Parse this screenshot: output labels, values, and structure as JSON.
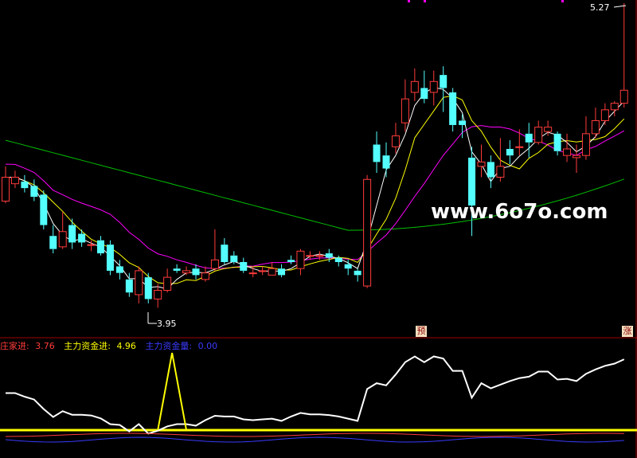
{
  "watermark": "www.6o7o.com",
  "markers": {
    "high": "5.27",
    "low": "3.95",
    "pre": "预",
    "up": "涨"
  },
  "legend": {
    "item1": {
      "label": "庄家进:",
      "value": "3.76",
      "color": "#ff3b3b"
    },
    "item2": {
      "label": "主力资金进:",
      "value": "4.96",
      "color": "#ffff00"
    },
    "item3": {
      "label": "主力资金量:",
      "value": "0.00",
      "color": "#3a3aff"
    }
  },
  "colors": {
    "up": "#ff3b3b",
    "down": "#54ffff",
    "ma5": "#ffffff",
    "ma10": "#ffff00",
    "ma20": "#ff00ff",
    "ma60": "#00c000",
    "separator": "#a00000"
  },
  "chart_data": {
    "type": "candlestick",
    "ylim": [
      3.9,
      5.35
    ],
    "candles": [
      [
        4.44,
        4.55,
        4.6,
        4.43
      ],
      [
        4.52,
        4.55,
        4.58,
        4.5
      ],
      [
        4.53,
        4.5,
        4.56,
        4.48
      ],
      [
        4.51,
        4.46,
        4.54,
        4.44
      ],
      [
        4.47,
        4.33,
        4.49,
        4.31
      ],
      [
        4.28,
        4.22,
        4.33,
        4.2
      ],
      [
        4.23,
        4.3,
        4.39,
        4.22
      ],
      [
        4.33,
        4.25,
        4.36,
        4.22
      ],
      [
        4.29,
        4.25,
        4.31,
        4.23
      ],
      [
        4.24,
        4.24,
        4.26,
        4.21
      ],
      [
        4.26,
        4.2,
        4.28,
        4.19
      ],
      [
        4.24,
        4.12,
        4.26,
        4.1
      ],
      [
        4.14,
        4.11,
        4.17,
        4.08
      ],
      [
        4.08,
        4.02,
        4.11,
        4.0
      ],
      [
        4.01,
        4.12,
        4.14,
        3.97
      ],
      [
        4.09,
        3.99,
        4.11,
        3.97
      ],
      [
        3.99,
        4.03,
        4.06,
        3.95
      ],
      [
        4.03,
        4.09,
        4.13,
        4.02
      ],
      [
        4.13,
        4.12,
        4.15,
        4.11
      ],
      [
        4.11,
        4.12,
        4.14,
        4.1
      ],
      [
        4.13,
        4.1,
        4.15,
        4.08
      ],
      [
        4.08,
        4.11,
        4.14,
        4.07
      ],
      [
        4.13,
        4.17,
        4.31,
        4.12
      ],
      [
        4.24,
        4.16,
        4.27,
        4.15
      ],
      [
        4.19,
        4.16,
        4.21,
        4.15
      ],
      [
        4.16,
        4.12,
        4.18,
        4.11
      ],
      [
        4.11,
        4.11,
        4.14,
        4.09
      ],
      [
        4.12,
        4.12,
        4.14,
        4.1
      ],
      [
        4.1,
        4.13,
        4.16,
        4.1
      ],
      [
        4.13,
        4.1,
        4.15,
        4.09
      ],
      [
        4.17,
        4.16,
        4.19,
        4.15
      ],
      [
        4.13,
        4.21,
        4.22,
        4.1
      ],
      [
        4.19,
        4.19,
        4.21,
        4.17
      ],
      [
        4.19,
        4.19,
        4.21,
        4.17
      ],
      [
        4.2,
        4.18,
        4.22,
        4.16
      ],
      [
        4.18,
        4.16,
        4.19,
        4.14
      ],
      [
        4.15,
        4.13,
        4.17,
        4.1
      ],
      [
        4.12,
        4.1,
        4.13,
        4.07
      ],
      [
        4.05,
        4.54,
        4.56,
        4.04
      ],
      [
        4.7,
        4.62,
        4.76,
        4.57
      ],
      [
        4.65,
        4.59,
        4.71,
        4.55
      ],
      [
        4.69,
        4.74,
        4.8,
        4.66
      ],
      [
        4.8,
        4.91,
        5.0,
        4.76
      ],
      [
        4.94,
        4.99,
        5.05,
        4.9
      ],
      [
        4.96,
        4.91,
        5.04,
        4.89
      ],
      [
        4.94,
        4.99,
        5.04,
        4.88
      ],
      [
        5.02,
        4.96,
        5.06,
        4.85
      ],
      [
        4.94,
        4.79,
        4.96,
        4.76
      ],
      [
        4.81,
        4.79,
        4.84,
        4.73
      ],
      [
        4.64,
        4.42,
        4.69,
        4.28
      ],
      [
        4.6,
        4.62,
        4.7,
        4.55
      ],
      [
        4.62,
        4.55,
        4.65,
        4.5
      ],
      [
        4.55,
        4.6,
        4.73,
        4.53
      ],
      [
        4.68,
        4.65,
        4.72,
        4.61
      ],
      [
        4.69,
        4.69,
        4.77,
        4.65
      ],
      [
        4.75,
        4.71,
        4.8,
        4.64
      ],
      [
        4.71,
        4.78,
        4.81,
        4.7
      ],
      [
        4.76,
        4.78,
        4.81,
        4.74
      ],
      [
        4.75,
        4.67,
        4.76,
        4.65
      ],
      [
        4.65,
        4.68,
        4.75,
        4.62
      ],
      [
        4.64,
        4.65,
        4.7,
        4.57
      ],
      [
        4.65,
        4.75,
        4.83,
        4.63
      ],
      [
        4.75,
        4.81,
        4.87,
        4.73
      ],
      [
        4.81,
        4.86,
        4.89,
        4.79
      ],
      [
        4.86,
        4.89,
        4.9,
        4.83
      ],
      [
        4.89,
        4.95,
        5.35,
        4.87
      ]
    ]
  }
}
